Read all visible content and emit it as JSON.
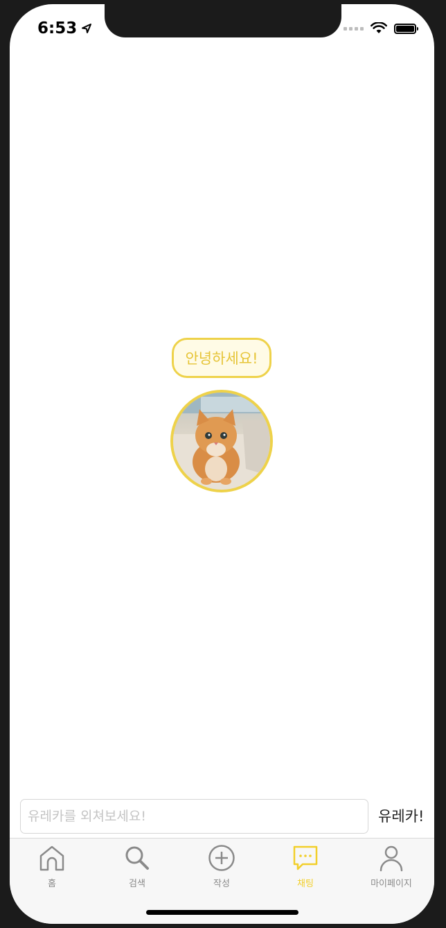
{
  "status_bar": {
    "time": "6:53"
  },
  "chat": {
    "greeting": "안녕하세요!"
  },
  "composer": {
    "placeholder": "유레카를 외쳐보세요!",
    "send_label": "유레카!"
  },
  "tabbar": {
    "active": "chat",
    "tabs": [
      {
        "id": "home",
        "label": "홈",
        "icon": "home-icon"
      },
      {
        "id": "search",
        "label": "검색",
        "icon": "search-icon"
      },
      {
        "id": "write",
        "label": "작성",
        "icon": "plus-circle-icon"
      },
      {
        "id": "chat",
        "label": "채팅",
        "icon": "chat-bubble-icon"
      },
      {
        "id": "mypage",
        "label": "마이페이지",
        "icon": "person-icon"
      }
    ]
  },
  "colors": {
    "accent": "#eed24a",
    "accent_text": "#e6c437",
    "inactive": "#8a8a8a"
  }
}
